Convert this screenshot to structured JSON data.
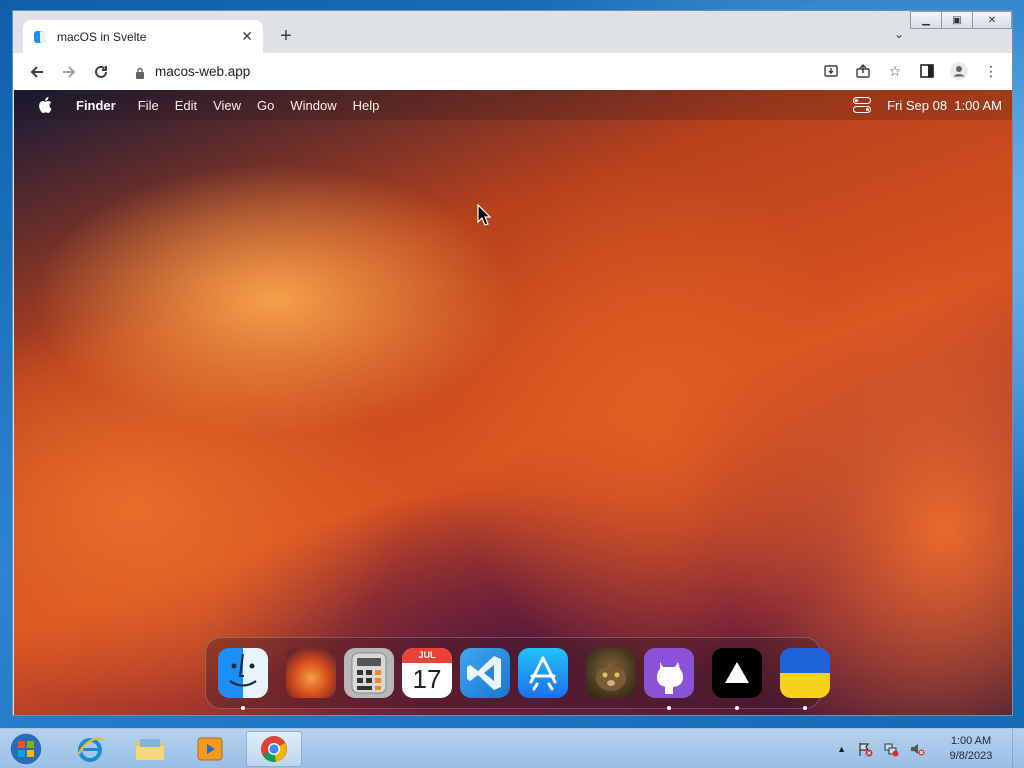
{
  "browser": {
    "tab_title": "macOS in Svelte",
    "url": "macos-web.app"
  },
  "mac": {
    "menu": {
      "app_name": "Finder",
      "items": [
        "File",
        "Edit",
        "View",
        "Go",
        "Window",
        "Help"
      ],
      "clock": "Fri Sep 08  1:00 AM"
    },
    "dock": {
      "items": [
        {
          "name": "finder",
          "running": true
        },
        {
          "name": "wallpapers",
          "running": false
        },
        {
          "name": "calculator",
          "running": false
        },
        {
          "name": "calendar",
          "running": false,
          "month": "JUL",
          "day": "17"
        },
        {
          "name": "vscode",
          "running": false
        },
        {
          "name": "app-store",
          "running": false
        },
        {
          "name": "purus-twitter",
          "running": false
        },
        {
          "name": "github",
          "running": true
        },
        {
          "name": "vercel",
          "running": true
        },
        {
          "name": "ukraine",
          "running": true
        }
      ]
    }
  },
  "taskbar": {
    "time": "1:00 AM",
    "date": "9/8/2023"
  },
  "colors": {
    "chrome_bg": "#dee1e6",
    "win_taskbar": "#b4d0ec",
    "mac_accent": "#e15e22"
  }
}
